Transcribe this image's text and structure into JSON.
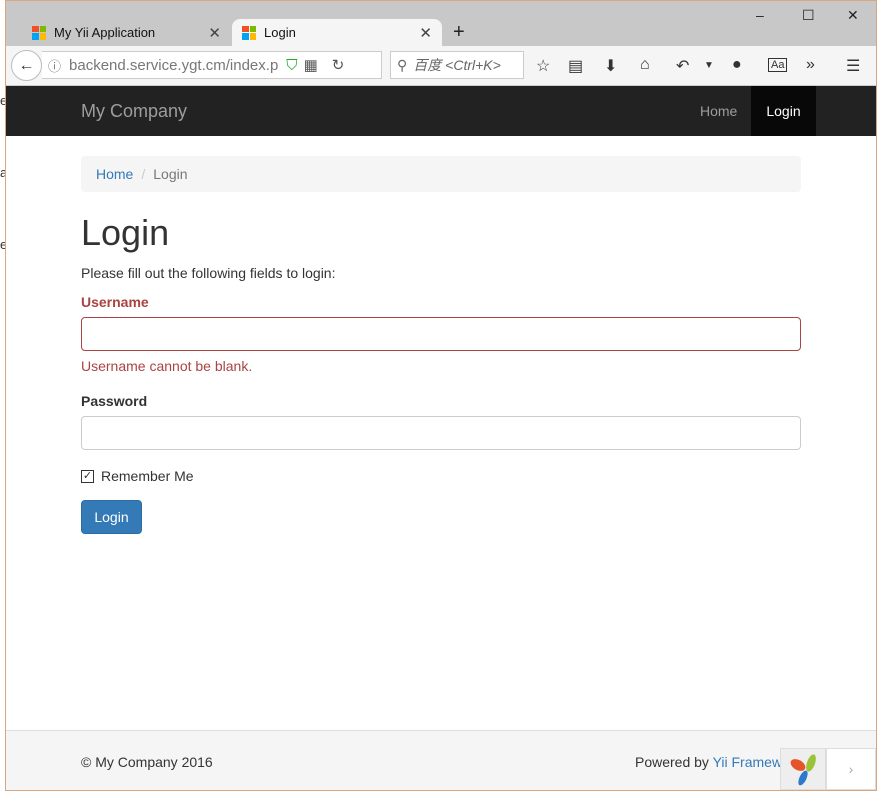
{
  "browser": {
    "tabs": [
      {
        "label": "My Yii Application"
      },
      {
        "label": "Login"
      }
    ],
    "url": "backend.service.ygt.cm/index.p",
    "search_placeholder": "百度 <Ctrl+K>"
  },
  "nav": {
    "brand": "My Company",
    "items": [
      {
        "label": "Home"
      },
      {
        "label": "Login"
      }
    ]
  },
  "breadcrumb": {
    "home": "Home",
    "current": "Login"
  },
  "page": {
    "title": "Login",
    "intro": "Please fill out the following fields to login:"
  },
  "form": {
    "username_label": "Username",
    "username_value": "",
    "username_error": "Username cannot be blank.",
    "password_label": "Password",
    "password_value": "",
    "remember_label": "Remember Me",
    "remember_checked": true,
    "submit_label": "Login"
  },
  "footer": {
    "copyright": "© My Company 2016",
    "powered_prefix": "Powered by ",
    "powered_link": "Yii Framew"
  }
}
